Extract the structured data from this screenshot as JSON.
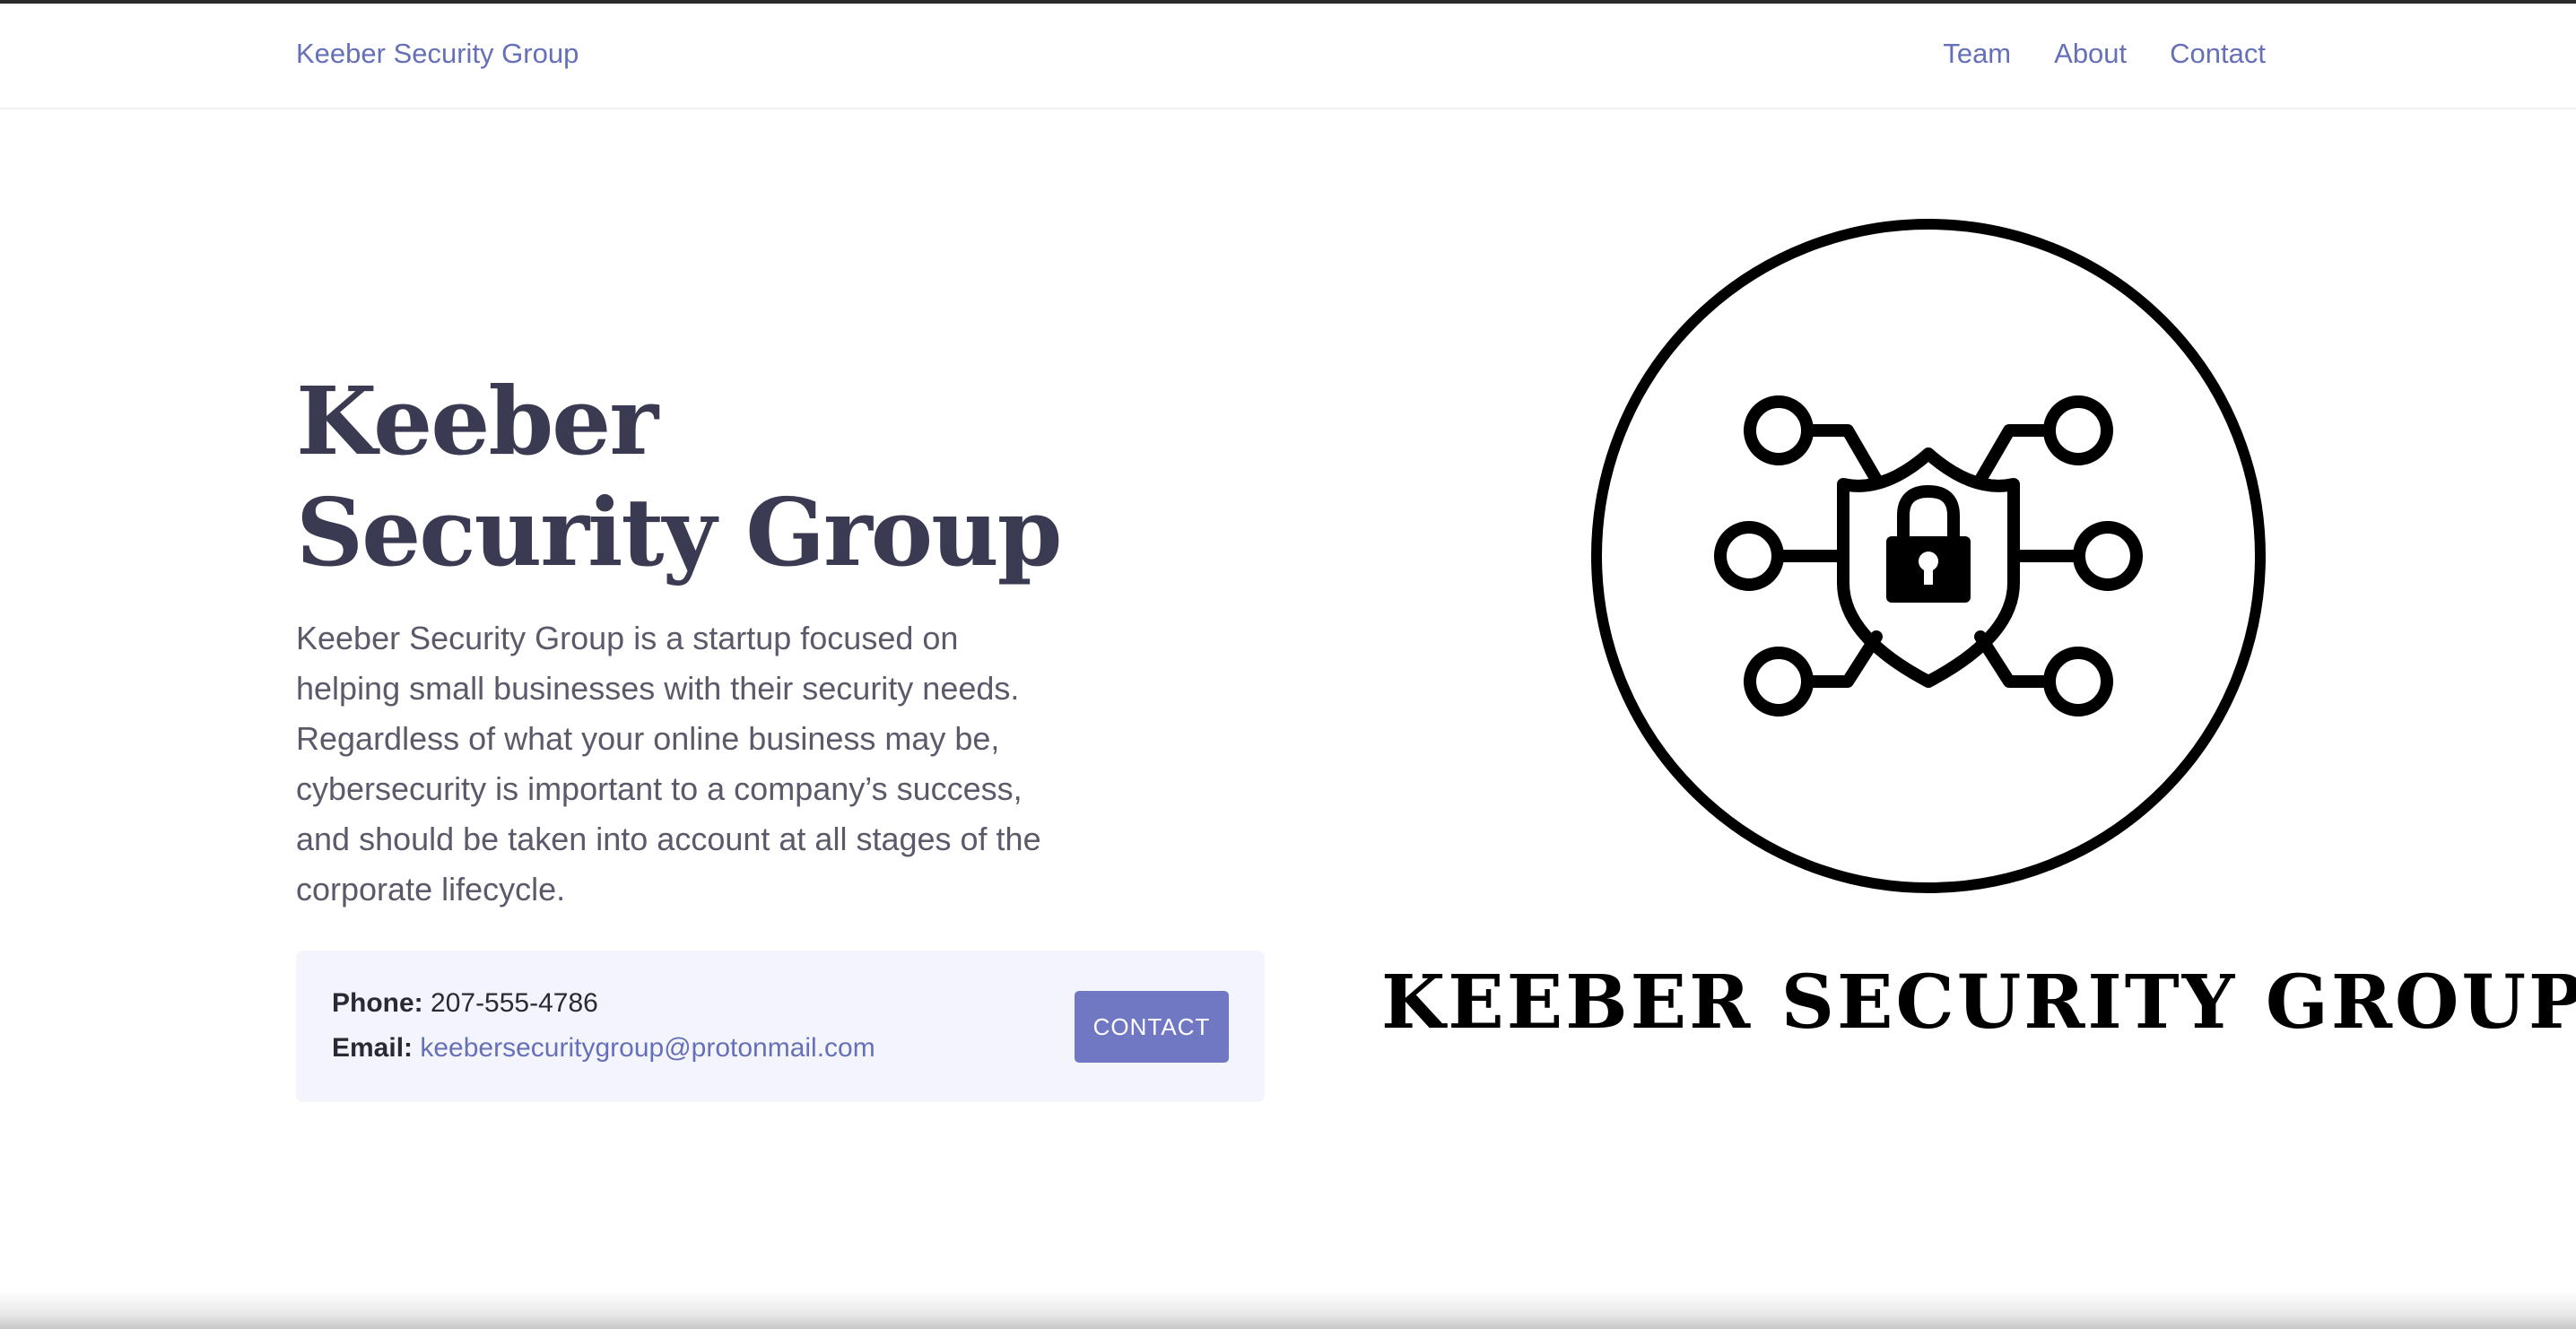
{
  "nav": {
    "brand": "Keeber Security Group",
    "links": [
      "Team",
      "About",
      "Contact"
    ]
  },
  "hero": {
    "title": "Keeber Security Group",
    "description": "Keeber Security Group is a startup focused on helping small businesses with their security needs. Regardless of what your online business may be, cybersecurity is important to a company’s success, and should be taken into account at all stages of the corporate lifecycle."
  },
  "contact": {
    "phone_label": "Phone:",
    "phone": "207-555-4786",
    "email_label": "Email:",
    "email": "keebersecuritygroup@protonmail.com",
    "button_label": "CONTACT"
  },
  "logo": {
    "text": "KEEBER SECURITY GROUP",
    "icon": "shield-lock-circuit-icon"
  },
  "colors": {
    "accent": "#6670b8",
    "button": "#7078c4",
    "heading": "#3a3a52",
    "card_bg": "#f4f5fc"
  }
}
